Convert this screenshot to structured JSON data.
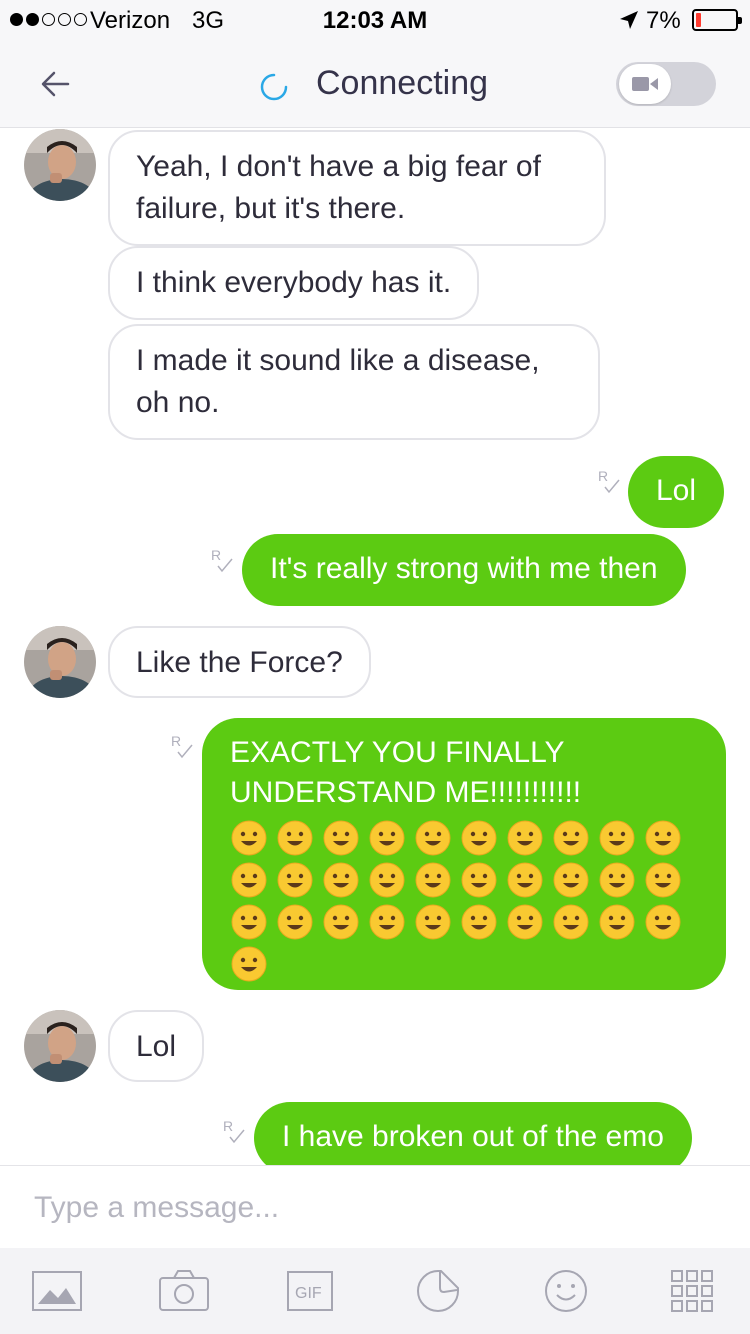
{
  "status_bar": {
    "carrier": "Verizon",
    "network": "3G",
    "time": "12:03 AM",
    "battery": "7%",
    "signal_bars": 2,
    "battery_level": 0.07
  },
  "header": {
    "title": "Connecting",
    "back_icon": "back-arrow-icon",
    "video_icon": "video-camera-icon"
  },
  "conversation": {
    "messages": [
      {
        "from": "them",
        "text": "Yeah, I don't have a big fear of failure, but it's there."
      },
      {
        "from": "them",
        "text": "I think everybody has it."
      },
      {
        "from": "them",
        "text": "I made it sound like a disease, oh no."
      },
      {
        "from": "me",
        "text": "Lol"
      },
      {
        "from": "me",
        "text": "It's really strong with me then"
      },
      {
        "from": "them",
        "text": "Like the Force?"
      },
      {
        "from": "me",
        "text": "EXACTLY YOU FINALLY UNDERSTAND ME!!!!!!!!!!!",
        "emojis": [
          "😀",
          "😃",
          "😄",
          "😁",
          "😆",
          "😅",
          "😂",
          "🤣",
          "☺️",
          "😊",
          "😇",
          "🙂",
          "🙃",
          "😉",
          "😌",
          "😘",
          "😘",
          "😗",
          "😙",
          "😚",
          "😋",
          "😜",
          "😝",
          "😛",
          "🤑",
          "🤗",
          "🤓",
          "😎",
          "🤠",
          "🤠",
          "😏"
        ]
      },
      {
        "from": "them",
        "text": "Lol"
      },
      {
        "from": "me",
        "text": "I have broken out of the emo"
      }
    ]
  },
  "composer": {
    "placeholder": "Type a message..."
  },
  "toolbar": {
    "gif_label": "GIF",
    "items": [
      "gallery-icon",
      "camera-icon",
      "gif-icon",
      "sticker-icon",
      "emoji-icon",
      "apps-grid-icon"
    ]
  },
  "colors": {
    "outgoing_bubble": "#5ccb12",
    "incoming_border": "#e3e3e8",
    "accent_blue": "#2aa8e6"
  }
}
